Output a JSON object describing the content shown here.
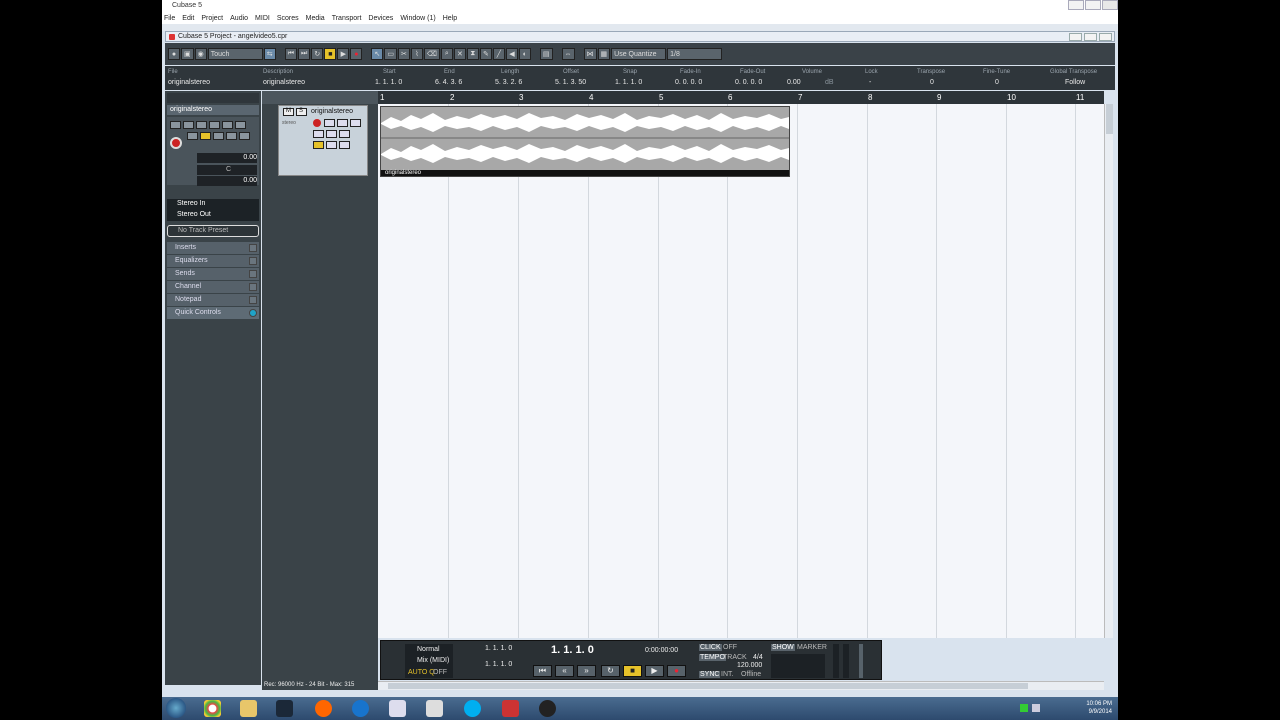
{
  "window": {
    "title": "Cubase 5",
    "controls": [
      "minimize-icon",
      "maximize-icon",
      "close-icon"
    ]
  },
  "menu": [
    "File",
    "Edit",
    "Project",
    "Audio",
    "MIDI",
    "Scores",
    "Media",
    "Transport",
    "Devices",
    "Window (1)",
    "Help"
  ],
  "project": {
    "title": "Cubase 5 Project - angelvideo5.cpr"
  },
  "toolbar": {
    "automation_mode": "Touch",
    "quantize_label": "Use Quantize",
    "quantize_value": "1/8"
  },
  "infoline": {
    "fields": [
      {
        "label": "File",
        "value": "originalstereo"
      },
      {
        "label": "Description",
        "value": "originalstereo"
      },
      {
        "label": "Start",
        "value": "1. 1. 1.   0"
      },
      {
        "label": "End",
        "value": "6. 4. 3.   6"
      },
      {
        "label": "Length",
        "value": "5. 3. 2.   6"
      },
      {
        "label": "Offset",
        "value": "5. 1. 3. 50"
      },
      {
        "label": "Snap",
        "value": "1. 1. 1.   0"
      },
      {
        "label": "Fade-In",
        "value": "0. 0. 0.   0"
      },
      {
        "label": "Fade-Out",
        "value": "0. 0. 0.   0"
      },
      {
        "label": "Volume",
        "value": "0.00"
      },
      {
        "label": "Lock",
        "value": "-"
      },
      {
        "label": "Transpose",
        "value": "0"
      },
      {
        "label": "Fine-Tune",
        "value": "0"
      },
      {
        "label": "Global Transpose",
        "value": "Follow"
      }
    ],
    "volume_unit": "dB"
  },
  "inspector": {
    "track_name": "originalstereo",
    "volume": "0.00",
    "pan": "C",
    "delay": "0.00",
    "input": "Stereo In",
    "output": "Stereo Out",
    "preset": "No Track Preset",
    "sections": [
      "Inserts",
      "Equalizers",
      "Sends",
      "Channel",
      "Notepad",
      "Quick Controls"
    ]
  },
  "track": {
    "name": "originalstereo",
    "type": "stereo",
    "mute": "M",
    "solo": "S"
  },
  "ruler": {
    "bars": [
      "1",
      "2",
      "3",
      "4",
      "5",
      "6",
      "7",
      "8",
      "9",
      "10",
      "11"
    ]
  },
  "event": {
    "name": "originalstereo"
  },
  "transport": {
    "mode1": "Normal",
    "mode2": "Mix (MIDI)",
    "auto_quantize": "AUTO Q",
    "auto_q_state": "OFF",
    "left_locator": "1. 1. 1.   0",
    "right_locator": "1. 1. 1.   0",
    "position": "1. 1. 1.   0",
    "time": "0:00:00:00",
    "click": "CLICK",
    "click_state": "OFF",
    "tempo": "TEMPO",
    "tempo_mode": "TRACK",
    "signature": "4/4",
    "bpm": "120.000",
    "sync": "SYNC",
    "sync_mode": "INT.",
    "sync_state": "Offline",
    "show": "SHOW",
    "marker": "MARKER"
  },
  "status": {
    "text": "Rec: 96000 Hz - 24 Bit - Max: 315"
  },
  "taskbar": {
    "time": "10:06 PM",
    "date": "9/9/2014"
  },
  "colors": {
    "accent": "#e6c22a",
    "record": "#cc2222",
    "quick_controls": "#1fa3c8"
  }
}
